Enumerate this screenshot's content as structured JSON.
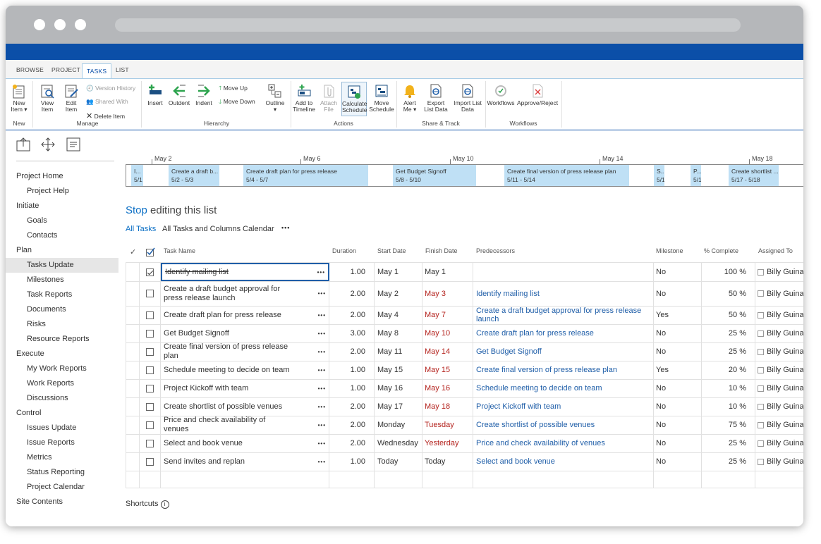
{
  "ribbon": {
    "tabs": [
      "BROWSE",
      "PROJECT",
      "TASKS",
      "LIST"
    ],
    "new_item": "New Item",
    "view_item": "View Item",
    "edit_item": "Edit Item",
    "version_history": "Version History",
    "shared_with": "Shared With",
    "delete_item": "Delete Item",
    "insert": "Insert",
    "outdent": "Outdent",
    "indent": "Indent",
    "move_up": "Move Up",
    "move_down": "Move Down",
    "outline": "Outline",
    "add_to_timeline": "Add to Timeline",
    "attach_file": "Attach File",
    "calculate_schedule": "Calculate Schedule",
    "move_schedule": "Move Schedule",
    "alert_me": "Alert Me",
    "export_list_data": "Export List Data",
    "import_list_data": "Import List Data",
    "workflows": "Workflows",
    "approve_reject": "Approve/Reject",
    "groups": [
      "New",
      "Manage",
      "Hierarchy",
      "Actions",
      "Share & Track",
      "Workflows"
    ]
  },
  "nav": [
    {
      "label": "Project Home",
      "level": 1
    },
    {
      "label": "Project Help",
      "level": 2
    },
    {
      "label": "Initiate",
      "level": 1
    },
    {
      "label": "Goals",
      "level": 2
    },
    {
      "label": "Contacts",
      "level": 2
    },
    {
      "label": "Plan",
      "level": 1
    },
    {
      "label": "Tasks Update",
      "level": 2,
      "selected": true
    },
    {
      "label": "Milestones",
      "level": 2
    },
    {
      "label": "Task Reports",
      "level": 2
    },
    {
      "label": "Documents",
      "level": 2
    },
    {
      "label": "Risks",
      "level": 2
    },
    {
      "label": "Resource Reports",
      "level": 2
    },
    {
      "label": "Execute",
      "level": 1
    },
    {
      "label": "My Work Reports",
      "level": 2
    },
    {
      "label": "Work Reports",
      "level": 2
    },
    {
      "label": "Discussions",
      "level": 2
    },
    {
      "label": "Control",
      "level": 1
    },
    {
      "label": "Issues Update",
      "level": 2
    },
    {
      "label": "Issue Reports",
      "level": 2
    },
    {
      "label": "Metrics",
      "level": 2
    },
    {
      "label": "Status Reporting",
      "level": 2
    },
    {
      "label": "Project Calendar",
      "level": 2
    },
    {
      "label": "Site Contents",
      "level": 1
    }
  ],
  "timeline": {
    "dates": [
      "May 2",
      "May 6",
      "May 10",
      "May 14",
      "May 18"
    ],
    "bars": [
      {
        "title": "I...",
        "dates": "5/1"
      },
      {
        "title": "Create a draft b...",
        "dates": "5/2 - 5/3"
      },
      {
        "title": "Create draft plan for press release",
        "dates": "5/4 - 5/7"
      },
      {
        "title": "Get Budget Signoff",
        "dates": "5/8 - 5/10"
      },
      {
        "title": "Create final version of press release plan",
        "dates": "5/11 - 5/14"
      },
      {
        "title": "S...",
        "dates": "5/1"
      },
      {
        "title": "P...",
        "dates": "5/1"
      },
      {
        "title": "Create shortlist ...",
        "dates": "5/17 - 5/18"
      }
    ]
  },
  "list": {
    "stop": "Stop",
    "title_rest": " editing this list",
    "views": [
      "All Tasks",
      "All Tasks and Columns",
      "Calendar"
    ],
    "more": "•••",
    "columns": [
      "Task Name",
      "Duration",
      "Start Date",
      "Finish Date",
      "Predecessors",
      "Milestone",
      "% Complete",
      "Assigned To"
    ],
    "rows": [
      {
        "checked": true,
        "task": "Identify mailing list",
        "duration": "1.00",
        "start": "May 1",
        "finish": "May 1",
        "finish_red": false,
        "pred": "",
        "milestone": "No",
        "pct": "100 %",
        "assigned": "Billy Guinan"
      },
      {
        "checked": false,
        "task": "Create a draft budget approval for press release launch",
        "duration": "2.00",
        "start": "May 2",
        "finish": "May 3",
        "finish_red": true,
        "pred": "Identify mailing list",
        "milestone": "No",
        "pct": "50 %",
        "assigned": "Billy Guinan"
      },
      {
        "checked": false,
        "task": "Create draft plan for press release",
        "duration": "2.00",
        "start": "May 4",
        "finish": "May 7",
        "finish_red": true,
        "pred": "Create a draft budget approval for press release launch",
        "milestone": "Yes",
        "pct": "50 %",
        "assigned": "Billy Guinan"
      },
      {
        "checked": false,
        "task": "Get Budget Signoff",
        "duration": "3.00",
        "start": "May 8",
        "finish": "May 10",
        "finish_red": true,
        "pred": "Create draft plan for press release",
        "milestone": "No",
        "pct": "25 %",
        "assigned": "Billy Guinan"
      },
      {
        "checked": false,
        "task": "Create final version of press release plan",
        "duration": "2.00",
        "start": "May 11",
        "finish": "May 14",
        "finish_red": true,
        "pred": "Get Budget Signoff",
        "milestone": "No",
        "pct": "25 %",
        "assigned": "Billy Guinan"
      },
      {
        "checked": false,
        "task": "Schedule meeting to decide on team",
        "duration": "1.00",
        "start": "May 15",
        "finish": "May 15",
        "finish_red": true,
        "pred": "Create final version of press release plan",
        "milestone": "Yes",
        "pct": "20 %",
        "assigned": "Billy Guinan"
      },
      {
        "checked": false,
        "task": "Project Kickoff with team",
        "duration": "1.00",
        "start": "May 16",
        "finish": "May 16",
        "finish_red": true,
        "pred": "Schedule meeting to decide on team",
        "milestone": "No",
        "pct": "10 %",
        "assigned": "Billy Guinan"
      },
      {
        "checked": false,
        "task": "Create shortlist of possible venues",
        "duration": "2.00",
        "start": "May 17",
        "finish": "May 18",
        "finish_red": true,
        "pred": "Project Kickoff with team",
        "milestone": "No",
        "pct": "10 %",
        "assigned": "Billy Guinan"
      },
      {
        "checked": false,
        "task": "Price and check availability of venues",
        "duration": "2.00",
        "start": "Monday",
        "finish": "Tuesday",
        "finish_red": true,
        "pred": "Create shortlist of possible venues",
        "milestone": "No",
        "pct": "75 %",
        "assigned": "Billy Guinan"
      },
      {
        "checked": false,
        "task": "Select and book venue",
        "duration": "2.00",
        "start": "Wednesday",
        "finish": "Yesterday",
        "finish_red": true,
        "pred": "Price and check availability of venues",
        "milestone": "No",
        "pct": "25 %",
        "assigned": "Billy Guinan"
      },
      {
        "checked": false,
        "task": "Send invites and replan",
        "duration": "1.00",
        "start": "Today",
        "finish": "Today",
        "finish_red": false,
        "pred": "Select and book venue",
        "milestone": "No",
        "pct": "25 %",
        "assigned": "Billy Guinan"
      }
    ]
  },
  "shortcuts": "Shortcuts",
  "colors": {
    "accent": "#0b4fa8",
    "link": "#1f5ea8",
    "overdue": "#b4231e",
    "timeline_bar": "#bfe0f5"
  }
}
